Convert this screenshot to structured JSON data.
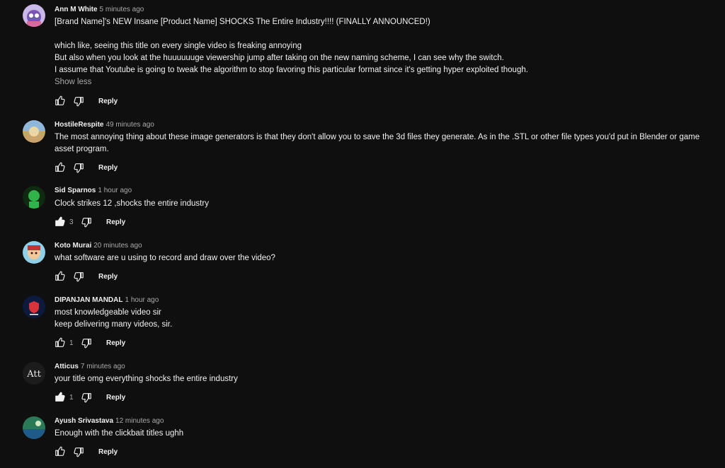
{
  "ui": {
    "reply_label": "Reply",
    "show_less_label": "Show less"
  },
  "comments": [
    {
      "author": "Ann M White",
      "time": "5 minutes ago",
      "text": "[Brand Name]'s NEW Insane [Product Name] SHOCKS The Entire Industry!!!! (FINALLY ANNOUNCED!)\n\nwhich like, seeing this title on every single video is freaking annoying\nBut also when you look at the huuuuuuge viewership jump after taking on the new naming scheme, I can see why the switch.\nI assume that Youtube is going to tweak the algorithm to stop favoring this particular format since it's getting hyper exploited though.",
      "likes": "",
      "liked": false
    },
    {
      "author": "HostileRespite",
      "time": "49 minutes ago",
      "text": "The most annoying thing about these image generators is that they don't allow you to save the 3d files they generate. As in the .STL or other file types you'd put in Blender or game asset program.",
      "likes": "",
      "liked": false
    },
    {
      "author": "Sid Sparnos",
      "time": "1 hour ago",
      "text": "Clock strikes 12 ,shocks the entire industry",
      "likes": "3",
      "liked": true
    },
    {
      "author": "Koto Murai",
      "time": "20 minutes ago",
      "text": "what software are u using to record and draw over the video?",
      "likes": "",
      "liked": false
    },
    {
      "author": "DIPANJAN MANDAL",
      "time": "1 hour ago",
      "text": "most knowledgeable video sir\nkeep delivering many videos, sir.",
      "likes": "1",
      "liked": false
    },
    {
      "author": "Atticus",
      "time": "7 minutes ago",
      "text": "your title omg everything shocks the entire industry",
      "likes": "1",
      "liked": true
    },
    {
      "author": "Ayush Srivastava",
      "time": "12 minutes ago",
      "text": "Enough with the clickbait titles ughh",
      "likes": "",
      "liked": false
    }
  ]
}
